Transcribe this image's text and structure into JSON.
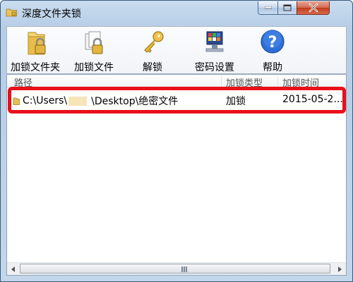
{
  "window": {
    "title": "深度文件夹锁"
  },
  "toolbar": {
    "items": [
      {
        "label": "加锁文件夹",
        "icon": "lock-folder-icon"
      },
      {
        "label": "加锁文件",
        "icon": "lock-file-icon"
      },
      {
        "label": "解锁",
        "icon": "key-icon"
      },
      {
        "label": "密码设置",
        "icon": "password-settings-icon"
      },
      {
        "label": "帮助",
        "icon": "help-icon"
      }
    ]
  },
  "list": {
    "columns": [
      "路径",
      "加锁类型",
      "加锁时间"
    ],
    "rows": [
      {
        "path_prefix": "C:\\Users\\",
        "path_suffix": "\\Desktop\\绝密文件",
        "type": "加锁",
        "time": "2015-05-2..."
      }
    ]
  },
  "colors": {
    "highlight": "#e8101a",
    "titlebar": "#b6cde6"
  }
}
